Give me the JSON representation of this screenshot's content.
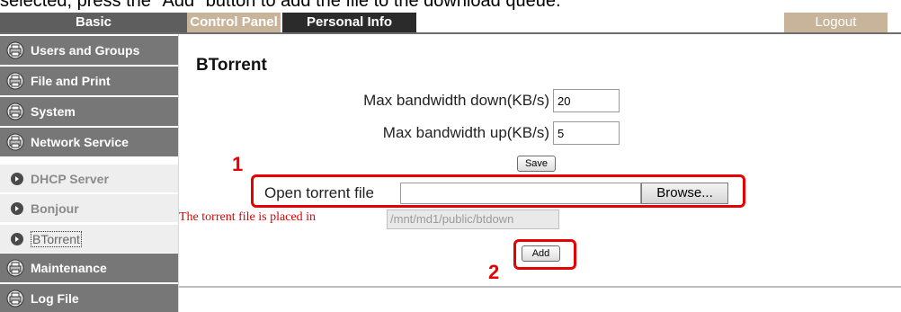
{
  "caption": "selected, press the \"Add\" button to add the file to the download queue.",
  "nav": {
    "basic": "Basic",
    "control_panel": "Control Panel",
    "personal_info": "Personal Info",
    "logout": "Logout"
  },
  "sidebar": {
    "items": [
      {
        "label": "Users and Groups"
      },
      {
        "label": "File and Print"
      },
      {
        "label": "System"
      },
      {
        "label": "Network Service"
      },
      {
        "label": "DHCP Server"
      },
      {
        "label": "Bonjour"
      },
      {
        "label": "BTorrent"
      },
      {
        "label": "Maintenance"
      },
      {
        "label": "Log File"
      }
    ]
  },
  "main": {
    "title": "BTorrent",
    "bw_down_label": "Max bandwidth down(KB/s)",
    "bw_down_value": "20",
    "bw_up_label": "Max bandwidth up(KB/s)",
    "bw_up_value": "5",
    "save_label": "Save",
    "open_file_label": "Open torrent file",
    "browse_label": "Browse...",
    "placed_label": "The torrent file is placed in",
    "placed_path": "/mnt/md1/public/btdown",
    "add_label": "Add"
  },
  "annotations": {
    "marker_1": "1",
    "marker_2": "2",
    "highlight_color": "#e60000"
  },
  "colors": {
    "nav_dark": "#5e5e5e",
    "nav_accent": "#c8b49a",
    "sidebar_dark": "#777777",
    "sidebar_light": "#eeeeee"
  }
}
